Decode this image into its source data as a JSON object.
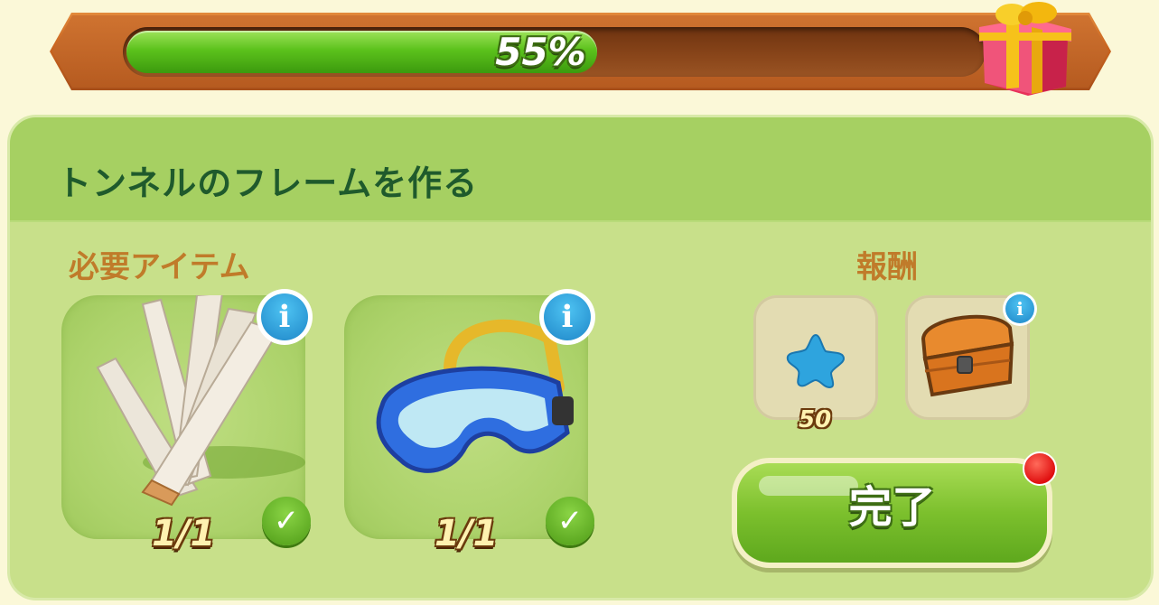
{
  "progress": {
    "percent": 0.55,
    "label": "55%"
  },
  "quest": {
    "title": "トンネルのフレームを作る"
  },
  "requirements": {
    "label": "必要アイテム",
    "items": [
      {
        "icon": "wooden-planks-icon",
        "count": "1/1",
        "complete": true
      },
      {
        "icon": "diving-goggles-icon",
        "count": "1/1",
        "complete": true
      }
    ]
  },
  "rewards": {
    "label": "報酬",
    "items": [
      {
        "icon": "blue-star-icon",
        "value": "50"
      },
      {
        "icon": "treasure-chest-icon",
        "value": ""
      }
    ]
  },
  "complete_button": {
    "label": "完了",
    "has_notification": true
  },
  "colors": {
    "progress_fill": "#5cc21c",
    "panel": "#c8e08a",
    "header": "#a6d062",
    "title": "#1f5a2c",
    "section_label": "#c07b2a",
    "button": "#7cc02d",
    "info": "#1e86c8"
  }
}
